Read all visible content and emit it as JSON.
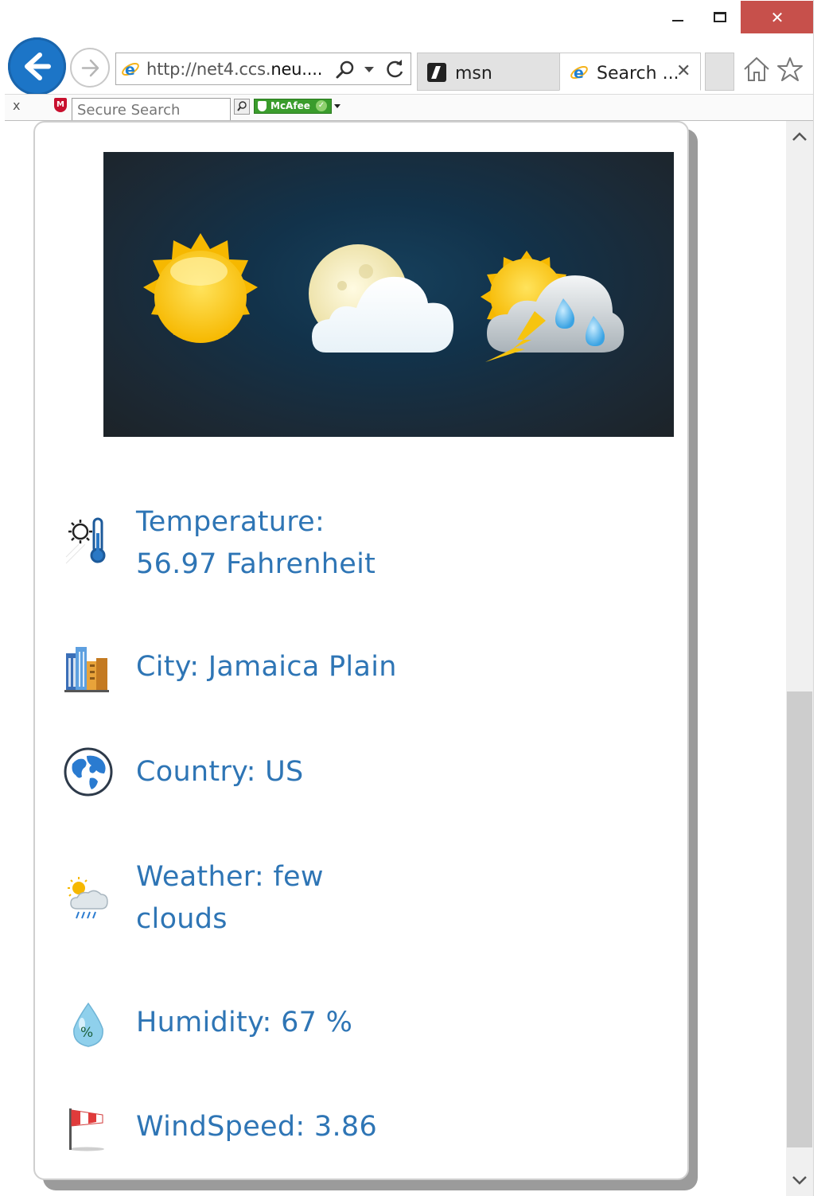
{
  "window": {
    "close_glyph": "✕"
  },
  "browser": {
    "address": {
      "prefix": "http://net4.ccs.",
      "domain": "neu....",
      "icon": "ie-logo-icon"
    },
    "tabs": [
      {
        "label": "msn",
        "icon": "msn-icon",
        "active": false
      },
      {
        "label": "Search ...",
        "icon": "ie-logo-icon",
        "active": true,
        "close_glyph": "✕"
      }
    ],
    "toolbar": {
      "close_glyph": "x",
      "search_placeholder": "Secure Search",
      "badge_label": "McAfee"
    }
  },
  "weather": {
    "rows": [
      {
        "label": "Temperature:",
        "value": "56.97 Fahrenheit",
        "icon": "thermometer-icon"
      },
      {
        "text": "City: Jamaica Plain",
        "icon": "city-buildings-icon"
      },
      {
        "text": "Country: US",
        "icon": "globe-icon"
      },
      {
        "text": "Weather: few clouds",
        "icon": "sun-rain-cloud-icon"
      },
      {
        "text": "Humidity: 67 %",
        "icon": "humidity-drop-icon"
      },
      {
        "text": "WindSpeed: 3.86",
        "icon": "windsock-icon"
      }
    ]
  },
  "colors": {
    "text_accent": "#2e75b5",
    "back_button": "#1c75c7",
    "close_button": "#c7504b",
    "banner_dark": "#1d2328"
  }
}
